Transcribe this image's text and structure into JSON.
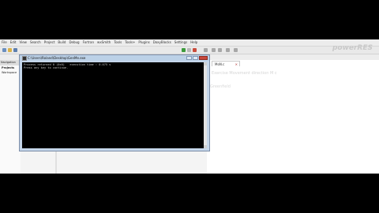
{
  "menu": [
    "File",
    "Edit",
    "View",
    "Search",
    "Project",
    "Build",
    "Debug",
    "Fortran",
    "wxSmith",
    "Tools",
    "Tools+",
    "Plugins",
    "DoxyBlocks",
    "Settings",
    "Help"
  ],
  "brand": {
    "logo_text": "powerRES"
  },
  "left_panel": {
    "tab_label": "Navigation",
    "projects_label": "Projects",
    "workspace_label": "Workspace"
  },
  "editor": {
    "tab_label": "MoN.c",
    "ghost_line1": "Exercise Movement direction M c",
    "ghost_line2": "Greenfield"
  },
  "console": {
    "title": "C:\\Users\\Roland\\Desktop\\GenMe.exe",
    "lines": [
      "Process returned 0 (0x0)   execution time : 0.075 s",
      "Press any key to continue."
    ]
  },
  "colors": {
    "accent": "#3a6ea5",
    "console_bg": "#000000",
    "console_text": "#c0c0c0",
    "close_button": "#c8473b"
  }
}
